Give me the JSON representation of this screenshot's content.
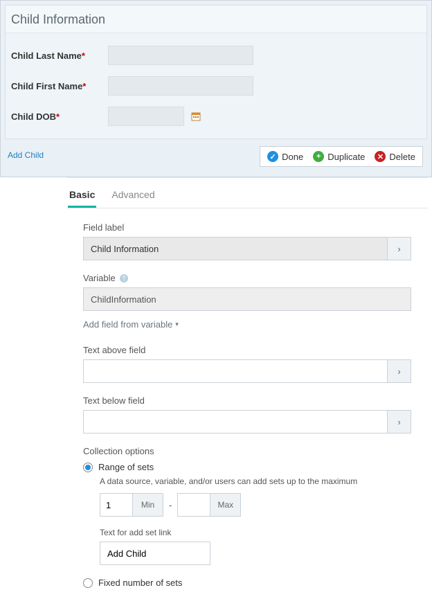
{
  "preview": {
    "group_title": "Child Information",
    "fields": {
      "last_name": {
        "label": "Child Last Name",
        "value": ""
      },
      "first_name": {
        "label": "Child First Name",
        "value": ""
      },
      "dob": {
        "label": "Child DOB",
        "value": ""
      }
    },
    "add_link": "Add Child"
  },
  "actions": {
    "done": "Done",
    "duplicate": "Duplicate",
    "delete": "Delete"
  },
  "tabs": {
    "basic": "Basic",
    "advanced": "Advanced"
  },
  "editor": {
    "field_label": {
      "label": "Field label",
      "value": "Child Information"
    },
    "variable": {
      "label": "Variable",
      "value": "ChildInformation"
    },
    "add_from_variable": "Add field from variable",
    "text_above": {
      "label": "Text above field",
      "value": ""
    },
    "text_below": {
      "label": "Text below field",
      "value": ""
    },
    "collection": {
      "header": "Collection options",
      "range_label": "Range of sets",
      "range_desc": "A data source, variable, and/or users can add sets up to the maximum",
      "min_value": "1",
      "min_label": "Min",
      "max_value": "",
      "max_label": "Max",
      "add_text_label": "Text for add set link",
      "add_text_value": "Add Child",
      "fixed_label": "Fixed number of sets"
    }
  }
}
